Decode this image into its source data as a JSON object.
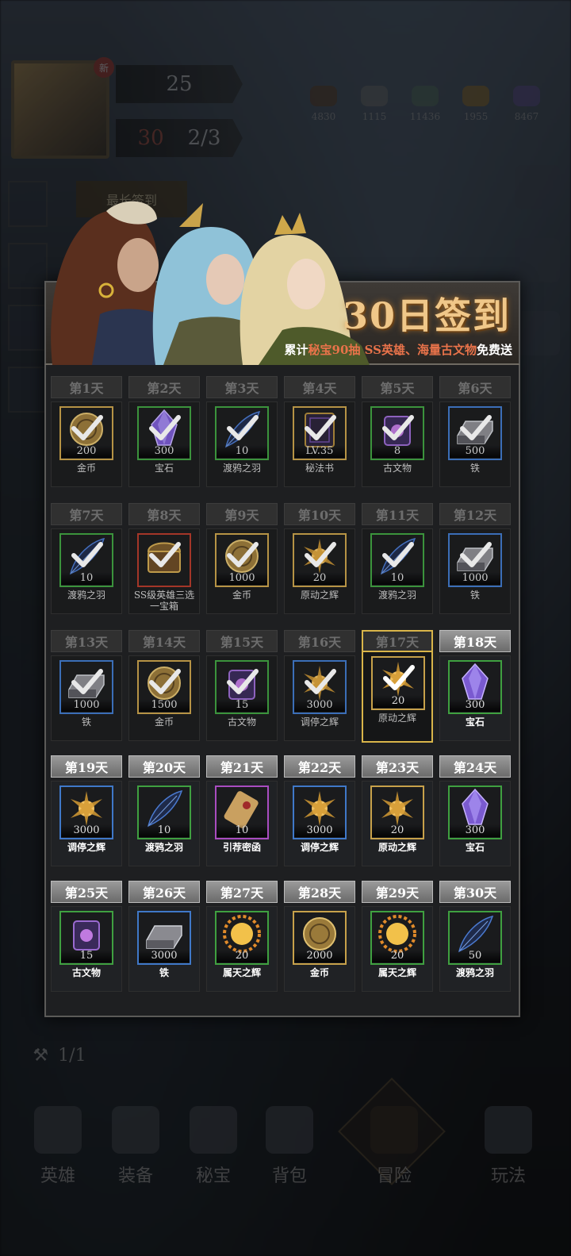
{
  "player": {
    "level": "30",
    "power": "25",
    "energy": "2/3",
    "badge": "新"
  },
  "resources": [
    {
      "icon": "wood-icon",
      "value": "4830"
    },
    {
      "icon": "stone-icon",
      "value": "1115"
    },
    {
      "icon": "ore-icon",
      "value": "11436"
    },
    {
      "icon": "gold-icon",
      "value": "1955"
    },
    {
      "icon": "crystal-icon",
      "value": "8467"
    }
  ],
  "side_chip": "最长签到",
  "counter": "1/1",
  "signin": {
    "title": "30日签到",
    "subtitle_prefix": "累计",
    "subtitle_hl": "秘宝90抽 SS英雄、海量古文物",
    "subtitle_suffix": "免费送",
    "days": [
      {
        "day": "第1天",
        "qty": "200",
        "name": "金币",
        "rarity": "gold",
        "icon": "coin",
        "state": "claimed"
      },
      {
        "day": "第2天",
        "qty": "300",
        "name": "宝石",
        "rarity": "green",
        "icon": "gem",
        "state": "claimed"
      },
      {
        "day": "第3天",
        "qty": "10",
        "name": "渡鸦之羽",
        "rarity": "green",
        "icon": "feather",
        "state": "claimed"
      },
      {
        "day": "第4天",
        "qty": "LV.35",
        "name": "秘法书",
        "rarity": "gold",
        "icon": "book",
        "state": "claimed"
      },
      {
        "day": "第5天",
        "qty": "8",
        "name": "古文物",
        "rarity": "green",
        "icon": "relic",
        "state": "claimed"
      },
      {
        "day": "第6天",
        "qty": "500",
        "name": "铁",
        "rarity": "blue",
        "icon": "iron",
        "state": "claimed"
      },
      {
        "day": "第7天",
        "qty": "10",
        "name": "渡鸦之羽",
        "rarity": "green",
        "icon": "feather",
        "state": "claimed"
      },
      {
        "day": "第8天",
        "qty": "",
        "name": "SS级英雄三选一宝箱",
        "rarity": "red",
        "icon": "chest",
        "state": "claimed"
      },
      {
        "day": "第9天",
        "qty": "1000",
        "name": "金币",
        "rarity": "gold",
        "icon": "coin",
        "state": "claimed"
      },
      {
        "day": "第10天",
        "qty": "20",
        "name": "原动之辉",
        "rarity": "gold",
        "icon": "radiance",
        "state": "claimed"
      },
      {
        "day": "第11天",
        "qty": "10",
        "name": "渡鸦之羽",
        "rarity": "green",
        "icon": "feather",
        "state": "claimed"
      },
      {
        "day": "第12天",
        "qty": "1000",
        "name": "铁",
        "rarity": "blue",
        "icon": "iron",
        "state": "claimed"
      },
      {
        "day": "第13天",
        "qty": "1000",
        "name": "铁",
        "rarity": "blue",
        "icon": "iron",
        "state": "claimed"
      },
      {
        "day": "第14天",
        "qty": "1500",
        "name": "金币",
        "rarity": "gold",
        "icon": "coin",
        "state": "claimed"
      },
      {
        "day": "第15天",
        "qty": "15",
        "name": "古文物",
        "rarity": "green",
        "icon": "relic",
        "state": "claimed"
      },
      {
        "day": "第16天",
        "qty": "3000",
        "name": "调停之辉",
        "rarity": "blue",
        "icon": "radiance",
        "state": "claimed"
      },
      {
        "day": "第17天",
        "qty": "20",
        "name": "原动之辉",
        "rarity": "gold",
        "icon": "radiance",
        "state": "today"
      },
      {
        "day": "第18天",
        "qty": "300",
        "name": "宝石",
        "rarity": "green",
        "icon": "gem",
        "state": "active"
      },
      {
        "day": "第19天",
        "qty": "3000",
        "name": "调停之辉",
        "rarity": "blue",
        "icon": "radiance",
        "state": "active"
      },
      {
        "day": "第20天",
        "qty": "10",
        "name": "渡鸦之羽",
        "rarity": "green",
        "icon": "feather",
        "state": "active"
      },
      {
        "day": "第21天",
        "qty": "10",
        "name": "引荐密函",
        "rarity": "purple",
        "icon": "scroll",
        "state": "active"
      },
      {
        "day": "第22天",
        "qty": "3000",
        "name": "调停之辉",
        "rarity": "blue",
        "icon": "radiance",
        "state": "active"
      },
      {
        "day": "第23天",
        "qty": "20",
        "name": "原动之辉",
        "rarity": "gold",
        "icon": "radiance",
        "state": "active"
      },
      {
        "day": "第24天",
        "qty": "300",
        "name": "宝石",
        "rarity": "green",
        "icon": "gem",
        "state": "active"
      },
      {
        "day": "第25天",
        "qty": "15",
        "name": "古文物",
        "rarity": "green",
        "icon": "relic",
        "state": "active"
      },
      {
        "day": "第26天",
        "qty": "3000",
        "name": "铁",
        "rarity": "blue",
        "icon": "iron",
        "state": "active"
      },
      {
        "day": "第27天",
        "qty": "20",
        "name": "属天之辉",
        "rarity": "green",
        "icon": "sun",
        "state": "active"
      },
      {
        "day": "第28天",
        "qty": "2000",
        "name": "金币",
        "rarity": "gold",
        "icon": "coin",
        "state": "active"
      },
      {
        "day": "第29天",
        "qty": "20",
        "name": "属天之辉",
        "rarity": "green",
        "icon": "sun",
        "state": "active"
      },
      {
        "day": "第30天",
        "qty": "50",
        "name": "渡鸦之羽",
        "rarity": "green",
        "icon": "feather",
        "state": "active"
      }
    ]
  },
  "nav": [
    {
      "label": "英雄"
    },
    {
      "label": "装备"
    },
    {
      "label": "秘宝"
    },
    {
      "label": "背包"
    },
    {
      "label": "冒险"
    },
    {
      "label": "玩法"
    }
  ]
}
